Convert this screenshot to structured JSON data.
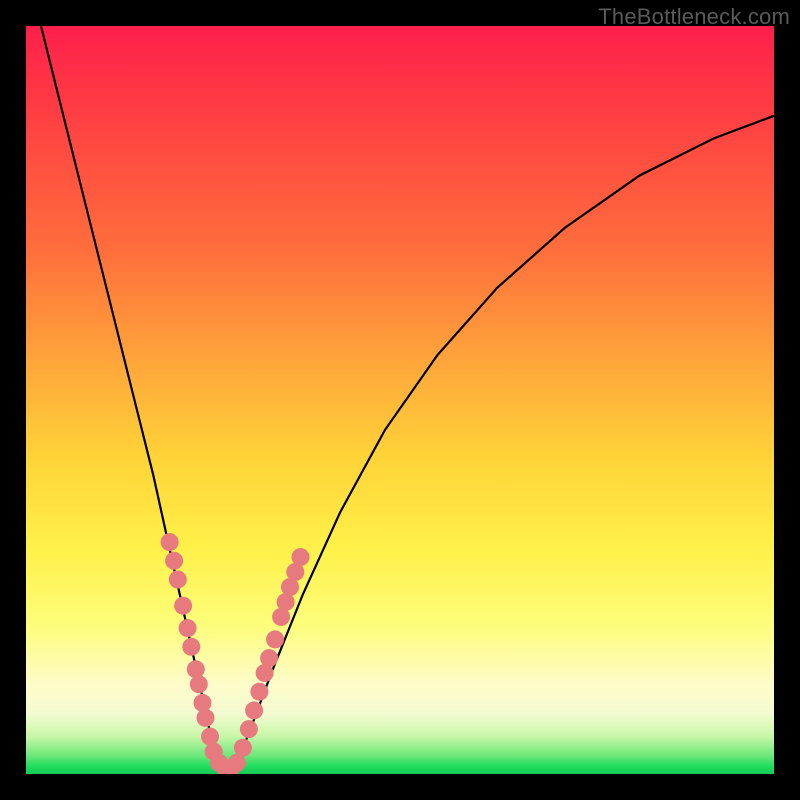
{
  "watermark": "TheBottleneck.com",
  "chart_data": {
    "type": "line",
    "title": "",
    "xlabel": "",
    "ylabel": "",
    "xlim": [
      0,
      100
    ],
    "ylim": [
      0,
      100
    ],
    "series": [
      {
        "name": "bottleneck-curve",
        "x": [
          2,
          5,
          8,
          11,
          14,
          17,
          19,
          21,
          23,
          24.5,
          26,
          28,
          30,
          33,
          37,
          42,
          48,
          55,
          63,
          72,
          82,
          92,
          100
        ],
        "y": [
          100,
          88,
          76,
          64,
          52,
          40,
          31,
          22,
          13,
          6,
          1,
          1,
          6,
          14,
          24,
          35,
          46,
          56,
          65,
          73,
          80,
          85,
          88
        ]
      }
    ],
    "markers": [
      {
        "name": "highlight-cluster",
        "color": "#e77a7f",
        "points": [
          {
            "x": 19.2,
            "y": 31
          },
          {
            "x": 19.8,
            "y": 28.5
          },
          {
            "x": 20.3,
            "y": 26
          },
          {
            "x": 21.0,
            "y": 22.5
          },
          {
            "x": 21.6,
            "y": 19.5
          },
          {
            "x": 22.1,
            "y": 17
          },
          {
            "x": 22.7,
            "y": 14
          },
          {
            "x": 23.1,
            "y": 12
          },
          {
            "x": 23.6,
            "y": 9.5
          },
          {
            "x": 24.0,
            "y": 7.5
          },
          {
            "x": 24.6,
            "y": 5
          },
          {
            "x": 25.1,
            "y": 3
          },
          {
            "x": 25.8,
            "y": 1.5
          },
          {
            "x": 26.6,
            "y": 0.8
          },
          {
            "x": 27.4,
            "y": 0.8
          },
          {
            "x": 28.2,
            "y": 1.5
          },
          {
            "x": 29.0,
            "y": 3.5
          },
          {
            "x": 29.8,
            "y": 6
          },
          {
            "x": 30.5,
            "y": 8.5
          },
          {
            "x": 31.2,
            "y": 11
          },
          {
            "x": 31.9,
            "y": 13.5
          },
          {
            "x": 32.5,
            "y": 15.5
          },
          {
            "x": 33.3,
            "y": 18
          },
          {
            "x": 34.1,
            "y": 21
          },
          {
            "x": 34.7,
            "y": 23
          },
          {
            "x": 35.3,
            "y": 25
          },
          {
            "x": 36.0,
            "y": 27
          },
          {
            "x": 36.7,
            "y": 29
          }
        ]
      }
    ],
    "background_gradient": {
      "stops": [
        {
          "pos": 0,
          "color": "#ff1f4b"
        },
        {
          "pos": 0.45,
          "color": "#ffa63a"
        },
        {
          "pos": 0.7,
          "color": "#fff14a"
        },
        {
          "pos": 0.92,
          "color": "#f4fbd1"
        },
        {
          "pos": 1.0,
          "color": "#18c957"
        }
      ]
    }
  }
}
